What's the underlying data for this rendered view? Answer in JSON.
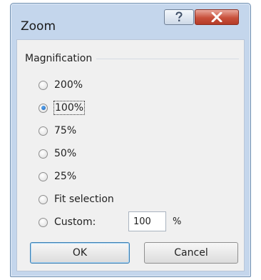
{
  "window": {
    "title": "Zoom",
    "help_icon": "question-mark-icon",
    "close_icon": "close-x-icon"
  },
  "magnification": {
    "group_label": "Magnification",
    "options": [
      {
        "label": "200%",
        "selected": false
      },
      {
        "label": "100%",
        "selected": true
      },
      {
        "label": "75%",
        "selected": false
      },
      {
        "label": "50%",
        "selected": false
      },
      {
        "label": "25%",
        "selected": false
      },
      {
        "label": "Fit selection",
        "selected": false
      },
      {
        "label": "Custom:",
        "selected": false
      }
    ],
    "custom_value": "100",
    "custom_unit": "%"
  },
  "buttons": {
    "ok_label": "OK",
    "cancel_label": "Cancel"
  },
  "colors": {
    "close_button": "#c8503b",
    "focus_border": "#3c7fb1",
    "radio_selected": "#1b5fb4"
  }
}
